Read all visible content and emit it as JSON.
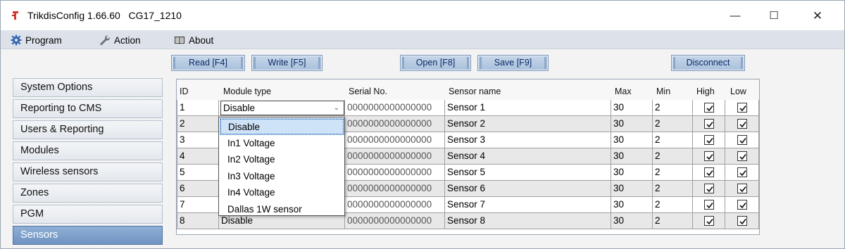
{
  "window": {
    "app_name": "TrikdisConfig 1.66.60",
    "device": "CG17_1210",
    "minimize": "—",
    "maximize": "☐",
    "close": "✕"
  },
  "menu": {
    "program": "Program",
    "action": "Action",
    "about": "About"
  },
  "toolbar": {
    "read": "Read [F4]",
    "write": "Write [F5]",
    "open": "Open [F8]",
    "save": "Save [F9]",
    "disconnect": "Disconnect"
  },
  "sidebar": {
    "items": [
      {
        "label": "System Options"
      },
      {
        "label": "Reporting to CMS"
      },
      {
        "label": "Users & Reporting"
      },
      {
        "label": "Modules"
      },
      {
        "label": "Wireless sensors"
      },
      {
        "label": "Zones"
      },
      {
        "label": "PGM"
      },
      {
        "label": "Sensors"
      }
    ],
    "active": "Sensors"
  },
  "table": {
    "columns": [
      "ID",
      "Module type",
      "Serial No.",
      "Sensor name",
      "Max",
      "Min",
      "High",
      "Low"
    ],
    "rows": [
      {
        "id": "1",
        "type": "Disable",
        "serial": "0000000000000000",
        "name": "Sensor 1",
        "max": "30",
        "min": "2",
        "high": true,
        "low": true
      },
      {
        "id": "2",
        "type": "",
        "serial": "0000000000000000",
        "name": "Sensor 2",
        "max": "30",
        "min": "2",
        "high": true,
        "low": true
      },
      {
        "id": "3",
        "type": "",
        "serial": "0000000000000000",
        "name": "Sensor 3",
        "max": "30",
        "min": "2",
        "high": true,
        "low": true
      },
      {
        "id": "4",
        "type": "",
        "serial": "0000000000000000",
        "name": "Sensor 4",
        "max": "30",
        "min": "2",
        "high": true,
        "low": true
      },
      {
        "id": "5",
        "type": "",
        "serial": "0000000000000000",
        "name": "Sensor 5",
        "max": "30",
        "min": "2",
        "high": true,
        "low": true
      },
      {
        "id": "6",
        "type": "",
        "serial": "0000000000000000",
        "name": "Sensor 6",
        "max": "30",
        "min": "2",
        "high": true,
        "low": true
      },
      {
        "id": "7",
        "type": "",
        "serial": "0000000000000000",
        "name": "Sensor 7",
        "max": "30",
        "min": "2",
        "high": true,
        "low": true
      },
      {
        "id": "8",
        "type": "Disable",
        "serial": "0000000000000000",
        "name": "Sensor 8",
        "max": "30",
        "min": "2",
        "high": true,
        "low": true
      }
    ]
  },
  "dropdown": {
    "options": [
      "Disable",
      "In1 Voltage",
      "In2 Voltage",
      "In3 Voltage",
      "In4 Voltage",
      "Dallas 1W sensor"
    ],
    "selected": "Disable"
  },
  "colors": {
    "accent": "#6f93c0",
    "button": "#a9c0db",
    "button_text": "#0b2a66"
  }
}
